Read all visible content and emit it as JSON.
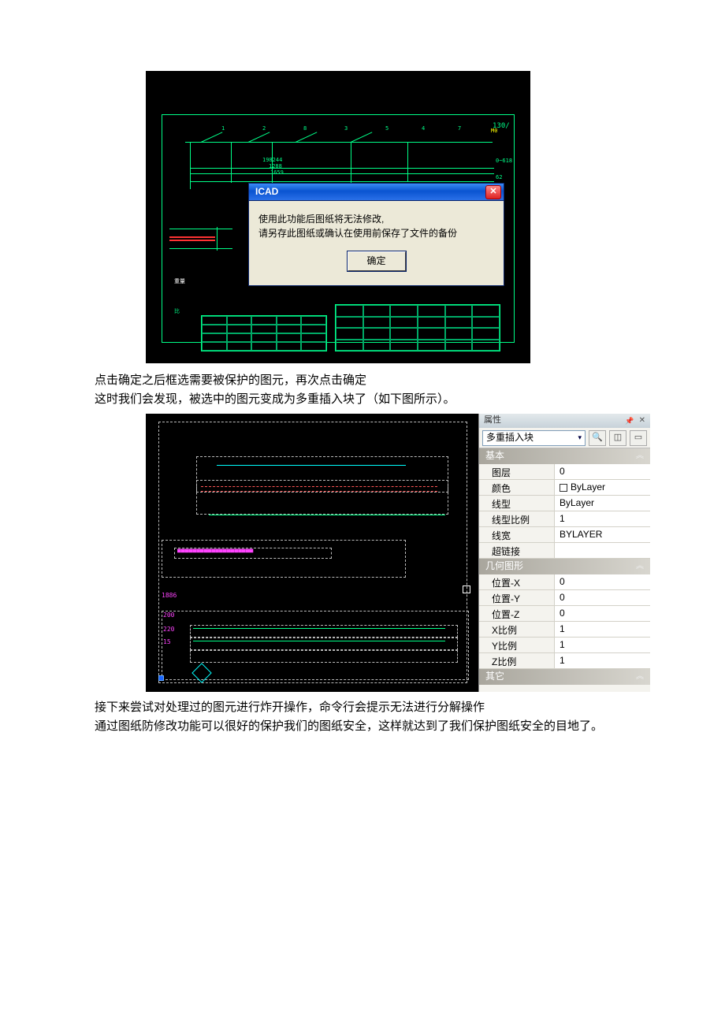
{
  "figure1": {
    "dialog": {
      "title": "ICAD",
      "line1": "使用此功能后图纸将无法修改,",
      "line2": "请另存此图纸或确认在使用前保存了文件的备份",
      "ok": "确定",
      "close_glyph": "✕"
    }
  },
  "text": {
    "p1": "点击确定之后框选需要被保护的图元，再次点击确定",
    "p2": "这时我们会发现，被选中的图元变成为多重插入块了（如下图所示）。",
    "p3": "接下来尝试对处理过的图元进行炸开操作，命令行会提示无法进行分解操作",
    "p4": "通过图纸防修改功能可以很好的保护我们的图纸安全，这样就达到了我们保护图纸安全的目地了。"
  },
  "properties": {
    "panel_title": "属性",
    "selector": "多重插入块",
    "sections": {
      "basic_title": "基本",
      "basic": [
        {
          "k": "图层",
          "v": "0"
        },
        {
          "k": "颜色",
          "v": "ByLayer",
          "swatch": true
        },
        {
          "k": "线型",
          "v": "ByLayer"
        },
        {
          "k": "线型比例",
          "v": "1"
        },
        {
          "k": "线宽",
          "v": "BYLAYER"
        },
        {
          "k": "超链接",
          "v": ""
        }
      ],
      "geom_title": "几何图形",
      "geom": [
        {
          "k": "位置-X",
          "v": "0"
        },
        {
          "k": "位置-Y",
          "v": "0"
        },
        {
          "k": "位置-Z",
          "v": "0"
        },
        {
          "k": "X比例",
          "v": "1"
        },
        {
          "k": "Y比例",
          "v": "1"
        },
        {
          "k": "Z比例",
          "v": "1"
        }
      ],
      "other_title": "其它"
    }
  }
}
